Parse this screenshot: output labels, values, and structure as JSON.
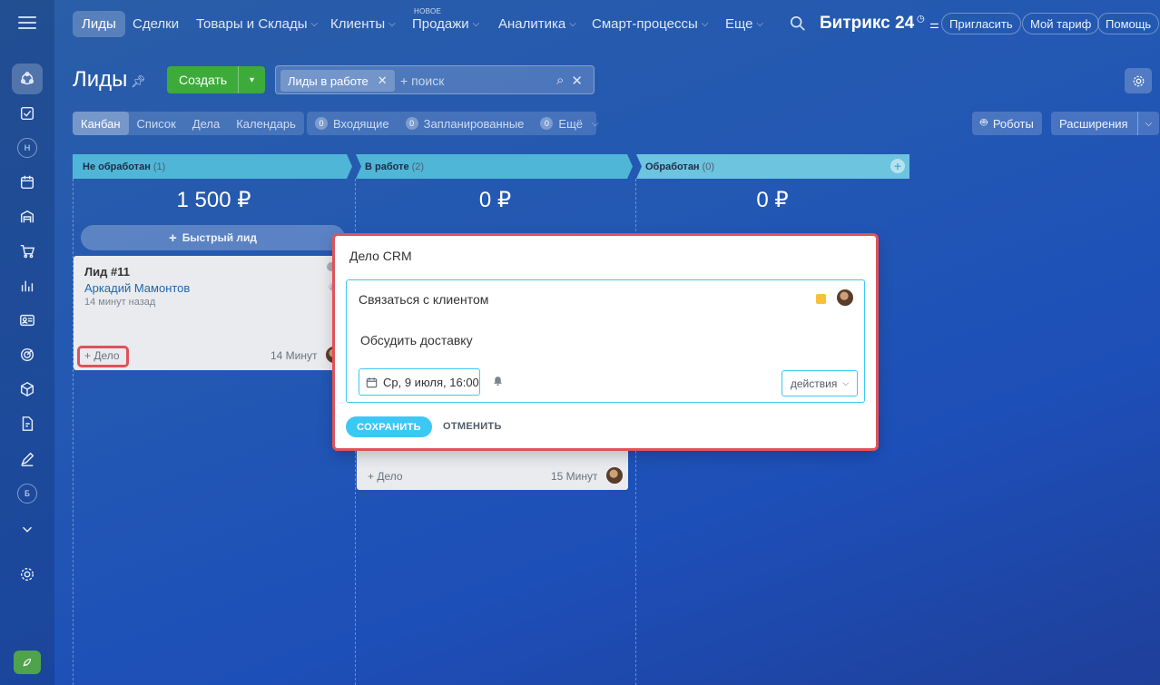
{
  "nav": {
    "items": [
      {
        "label": "Лиды",
        "chevron": false
      },
      {
        "label": "Сделки",
        "chevron": false
      },
      {
        "label": "Товары и Склады",
        "chevron": true
      },
      {
        "label": "Клиенты",
        "chevron": true
      },
      {
        "label": "Продажи",
        "chevron": true,
        "badge": "НОВОЕ"
      },
      {
        "label": "Аналитика",
        "chevron": true
      },
      {
        "label": "Смарт-процессы",
        "chevron": true
      },
      {
        "label": "Еще",
        "chevron": true
      }
    ],
    "brand": "Битрикс 24",
    "invite": "Пригласить",
    "tariff": "Мой тариф",
    "help": "Помощь"
  },
  "rail": {
    "letters": [
      "Н",
      "Б"
    ]
  },
  "page": {
    "title": "Лиды",
    "create_label": "Создать",
    "filter_tag": "Лиды в работе",
    "search_placeholder": "+ поиск"
  },
  "views": [
    "Канбан",
    "Список",
    "Дела",
    "Календарь"
  ],
  "counters": [
    {
      "num": "0",
      "label": "Входящие"
    },
    {
      "num": "0",
      "label": "Запланированные"
    },
    {
      "num": "0",
      "label": "Ещё"
    }
  ],
  "robots_label": "Роботы",
  "extensions_label": "Расширения",
  "columns": [
    {
      "title": "Не обработан",
      "count": "(1)",
      "sum": "1 500 ₽",
      "color": "#4fb6d8"
    },
    {
      "title": "В работе",
      "count": "(2)",
      "sum": "0 ₽",
      "color": "#4fb6d8"
    },
    {
      "title": "Обработан",
      "count": "(0)",
      "sum": "0 ₽",
      "color": "#63c0dc"
    }
  ],
  "quick_lead": "Быстрый лид",
  "card1": {
    "title": "Лид #11",
    "contact": "Аркадий Мамонтов",
    "ago": "14 минут назад",
    "add_deal": "+ Дело",
    "time": "14 Минут"
  },
  "card2": {
    "add_deal": "+ Дело",
    "time": "15 Минут"
  },
  "modal": {
    "title": "Дело CRM",
    "subject": "Связаться с клиентом",
    "description": "Обсудить доставку",
    "date": "Ср, 9 июля, 16:00",
    "actions": "действия",
    "save": "СОХРАНИТЬ",
    "cancel": "ОТМЕНИТЬ",
    "priority_color": "#f7c137"
  },
  "colors": {
    "accent": "#3bc8f5",
    "create": "#3dab3a",
    "highlight": "#e0525a"
  }
}
